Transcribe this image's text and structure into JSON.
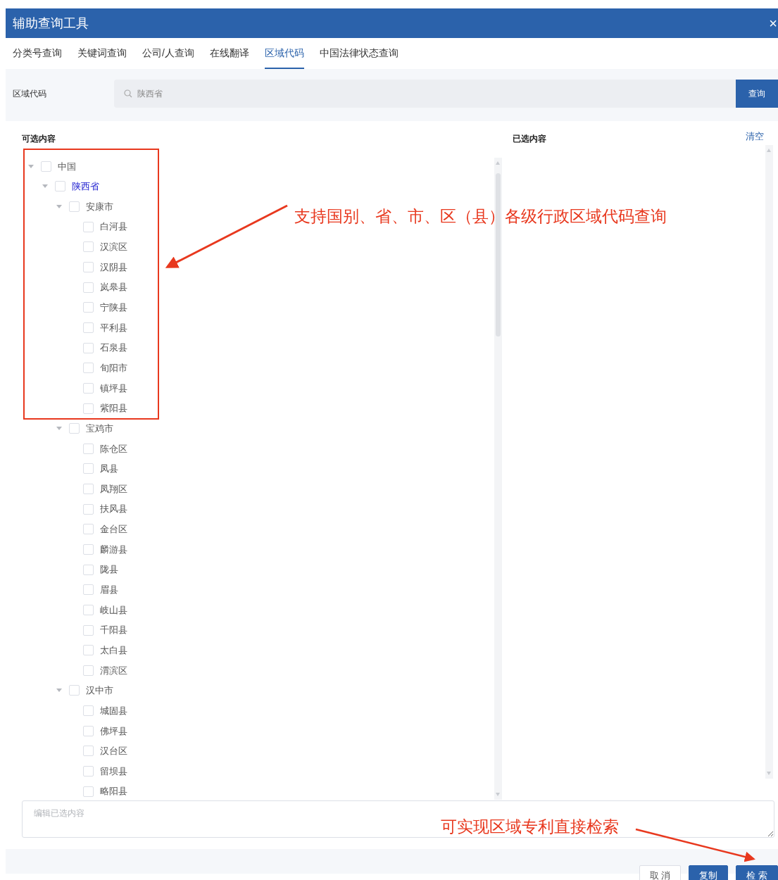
{
  "window": {
    "title": "辅助查询工具",
    "close": "×"
  },
  "tabs": [
    {
      "label": "分类号查询",
      "selected": false
    },
    {
      "label": "关键词查询",
      "selected": false
    },
    {
      "label": "公司/人查询",
      "selected": false
    },
    {
      "label": "在线翻译",
      "selected": false
    },
    {
      "label": "区域代码",
      "selected": true
    },
    {
      "label": "中国法律状态查询",
      "selected": false
    }
  ],
  "search": {
    "label": "区域代码",
    "value": "陕西省",
    "button": "查询"
  },
  "available": {
    "title": "可选内容",
    "tree": [
      {
        "label": "中国",
        "expanded": true,
        "checked": false,
        "highlighted": false,
        "children": [
          {
            "label": "陕西省",
            "expanded": true,
            "checked": false,
            "highlighted": true,
            "children": [
              {
                "label": "安康市",
                "expanded": true,
                "checked": false,
                "highlighted": false,
                "children": [
                  {
                    "label": "白河县",
                    "checked": false,
                    "highlighted": false
                  },
                  {
                    "label": "汉滨区",
                    "checked": false,
                    "highlighted": false
                  },
                  {
                    "label": "汉阴县",
                    "checked": false,
                    "highlighted": false
                  },
                  {
                    "label": "岚皋县",
                    "checked": false,
                    "highlighted": false
                  },
                  {
                    "label": "宁陕县",
                    "checked": false,
                    "highlighted": false
                  },
                  {
                    "label": "平利县",
                    "checked": false,
                    "highlighted": false
                  },
                  {
                    "label": "石泉县",
                    "checked": false,
                    "highlighted": false
                  },
                  {
                    "label": "旬阳市",
                    "checked": false,
                    "highlighted": false
                  },
                  {
                    "label": "镇坪县",
                    "checked": false,
                    "highlighted": false
                  },
                  {
                    "label": "紫阳县",
                    "checked": false,
                    "highlighted": false
                  }
                ]
              },
              {
                "label": "宝鸡市",
                "expanded": true,
                "checked": false,
                "highlighted": false,
                "children": [
                  {
                    "label": "陈仓区",
                    "checked": false,
                    "highlighted": false
                  },
                  {
                    "label": "凤县",
                    "checked": false,
                    "highlighted": false
                  },
                  {
                    "label": "凤翔区",
                    "checked": false,
                    "highlighted": false
                  },
                  {
                    "label": "扶风县",
                    "checked": false,
                    "highlighted": false
                  },
                  {
                    "label": "金台区",
                    "checked": false,
                    "highlighted": false
                  },
                  {
                    "label": "麟游县",
                    "checked": false,
                    "highlighted": false
                  },
                  {
                    "label": "陇县",
                    "checked": false,
                    "highlighted": false
                  },
                  {
                    "label": "眉县",
                    "checked": false,
                    "highlighted": false
                  },
                  {
                    "label": "岐山县",
                    "checked": false,
                    "highlighted": false
                  },
                  {
                    "label": "千阳县",
                    "checked": false,
                    "highlighted": false
                  },
                  {
                    "label": "太白县",
                    "checked": false,
                    "highlighted": false
                  },
                  {
                    "label": "渭滨区",
                    "checked": false,
                    "highlighted": false
                  }
                ]
              },
              {
                "label": "汉中市",
                "expanded": true,
                "checked": false,
                "highlighted": false,
                "children": [
                  {
                    "label": "城固县",
                    "checked": false,
                    "highlighted": false
                  },
                  {
                    "label": "佛坪县",
                    "checked": false,
                    "highlighted": false
                  },
                  {
                    "label": "汉台区",
                    "checked": false,
                    "highlighted": false
                  },
                  {
                    "label": "留坝县",
                    "checked": false,
                    "highlighted": false
                  },
                  {
                    "label": "略阳县",
                    "checked": false,
                    "highlighted": false
                  }
                ]
              }
            ]
          }
        ]
      }
    ]
  },
  "selected_panel": {
    "title": "已选内容",
    "clear": "清空"
  },
  "editor": {
    "placeholder": "编辑已选内容"
  },
  "buttons": [
    {
      "label": "取 消",
      "kind": "secondary"
    },
    {
      "label": "复制",
      "kind": "primary"
    },
    {
      "label": "检 索",
      "kind": "primary"
    }
  ],
  "annotations": [
    {
      "text": "支持国别、省、市、区（县）各级行政区域代码查询"
    },
    {
      "text": "可实现区域专利直接检索"
    }
  ]
}
